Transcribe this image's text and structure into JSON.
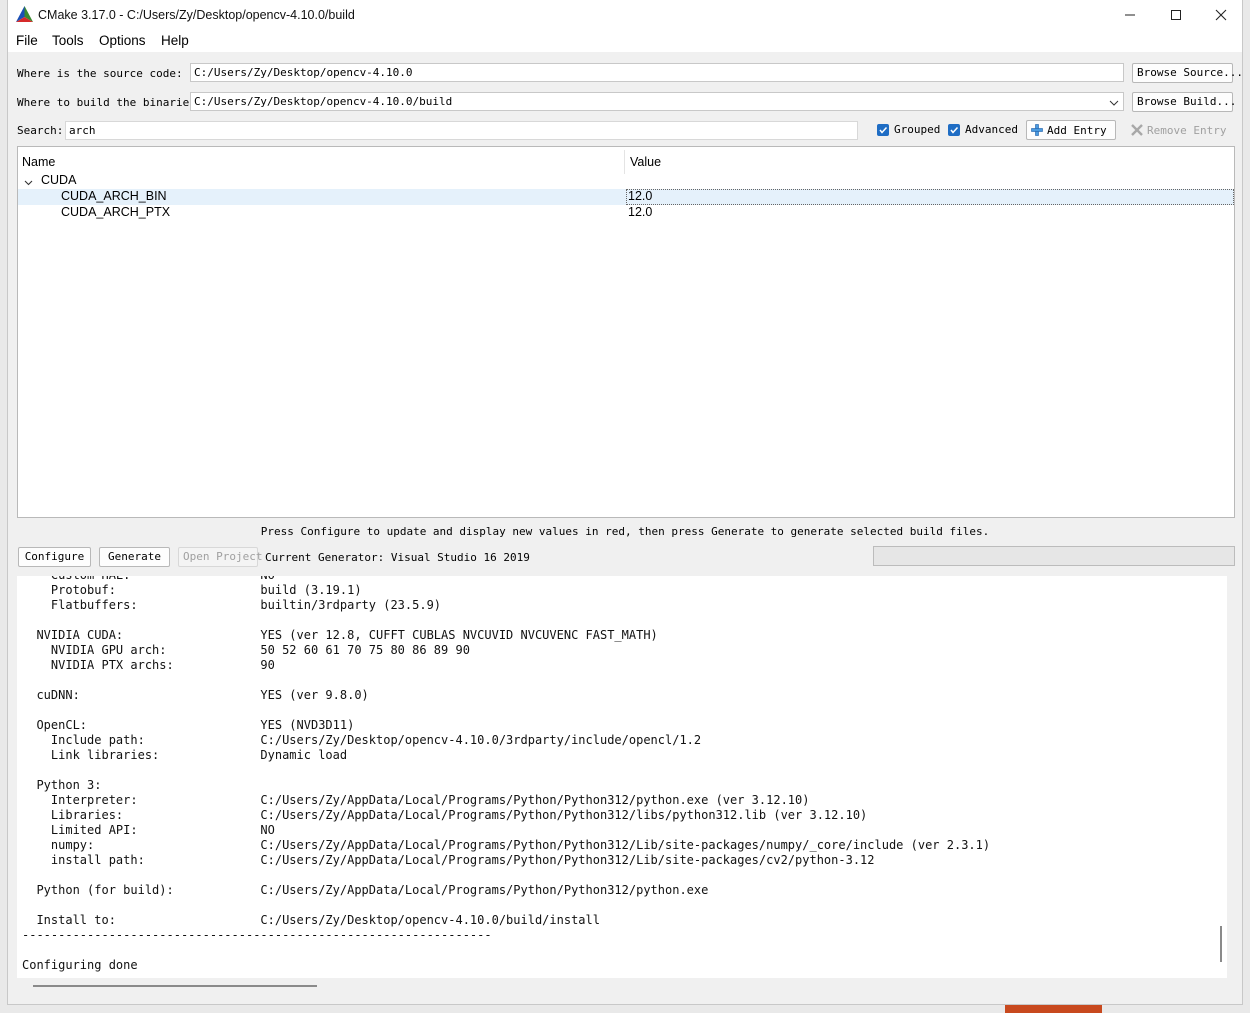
{
  "window": {
    "title": "CMake 3.17.0 - C:/Users/Zy/Desktop/opencv-4.10.0/build",
    "minimize_label": "minimize",
    "maximize_label": "maximize",
    "close_label": "close"
  },
  "menu": {
    "file": "File",
    "tools": "Tools",
    "options": "Options",
    "help": "Help"
  },
  "paths": {
    "source_label": "Where is the source code:",
    "source_value": "C:/Users/Zy/Desktop/opencv-4.10.0",
    "browse_source": "Browse Source...",
    "build_label": "Where to build the binaries:",
    "build_value": "C:/Users/Zy/Desktop/opencv-4.10.0/build",
    "browse_build": "Browse Build..."
  },
  "search": {
    "label": "Search:",
    "value": "arch",
    "grouped": "Grouped",
    "advanced": "Advanced",
    "add_entry": "Add Entry",
    "remove_entry": "Remove Entry"
  },
  "tree": {
    "col_name": "Name",
    "col_value": "Value",
    "group": "CUDA",
    "rows": [
      {
        "name": "CUDA_ARCH_BIN",
        "value": "12.0"
      },
      {
        "name": "CUDA_ARCH_PTX",
        "value": "12.0"
      }
    ]
  },
  "hint": "Press Configure to update and display new values in red, then press Generate to generate selected build files.",
  "actions": {
    "configure": "Configure",
    "generate": "Generate",
    "open_project": "Open Project",
    "current_generator": "Current Generator: Visual Studio 16 2019"
  },
  "output_lines": [
    "    Custom HAL:                  NO",
    "    Protobuf:                    build (3.19.1)",
    "    Flatbuffers:                 builtin/3rdparty (23.5.9)",
    "",
    "  NVIDIA CUDA:                   YES (ver 12.8, CUFFT CUBLAS NVCUVID NVCUVENC FAST_MATH)",
    "    NVIDIA GPU arch:             50 52 60 61 70 75 80 86 89 90",
    "    NVIDIA PTX archs:            90",
    "",
    "  cuDNN:                         YES (ver 9.8.0)",
    "",
    "  OpenCL:                        YES (NVD3D11)",
    "    Include path:                C:/Users/Zy/Desktop/opencv-4.10.0/3rdparty/include/opencl/1.2",
    "    Link libraries:              Dynamic load",
    "",
    "  Python 3:",
    "    Interpreter:                 C:/Users/Zy/AppData/Local/Programs/Python/Python312/python.exe (ver 3.12.10)",
    "    Libraries:                   C:/Users/Zy/AppData/Local/Programs/Python/Python312/libs/python312.lib (ver 3.12.10)",
    "    Limited API:                 NO",
    "    numpy:                       C:/Users/Zy/AppData/Local/Programs/Python/Python312/Lib/site-packages/numpy/_core/include (ver 2.3.1)",
    "    install path:                C:/Users/Zy/AppData/Local/Programs/Python/Python312/Lib/site-packages/cv2/python-3.12",
    "",
    "  Python (for build):            C:/Users/Zy/AppData/Local/Programs/Python/Python312/python.exe",
    "",
    "  Install to:                    C:/Users/Zy/Desktop/opencv-4.10.0/build/install",
    "-----------------------------------------------------------------",
    "",
    "Configuring done"
  ]
}
